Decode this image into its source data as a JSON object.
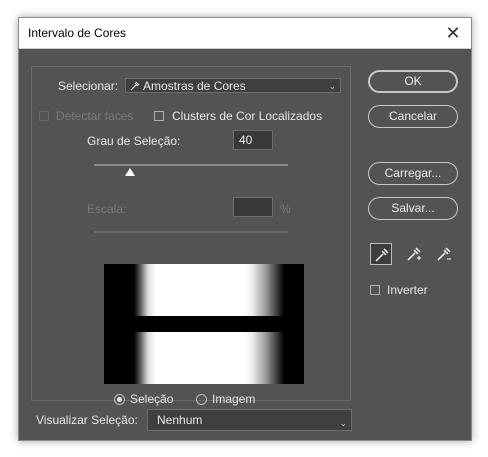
{
  "window": {
    "title": "Intervalo de Cores",
    "close_glyph": "✕"
  },
  "select": {
    "label": "Selecionar:",
    "value": "Amostras de Cores",
    "icon": "eyedropper-icon"
  },
  "options": {
    "detect_faces": "Detectar faces",
    "localized_clusters": "Clusters de Cor Localizados"
  },
  "fuzziness": {
    "label": "Grau de Seleção:",
    "value": "40",
    "slider_fraction": 0.2
  },
  "scale": {
    "label": "Escala:",
    "value": "",
    "unit": "%"
  },
  "preview": {
    "selection_label": "Seleção",
    "image_label": "Imagem",
    "selected": "selection"
  },
  "bottom": {
    "label": "Visualizar Seleção:",
    "value": "Nenhum"
  },
  "buttons": {
    "ok": "OK",
    "cancel": "Cancelar",
    "load": "Carregar...",
    "save": "Salvar..."
  },
  "tools": [
    "eyedropper-icon",
    "eyedropper-plus-icon",
    "eyedropper-minus-icon"
  ],
  "invert": {
    "label": "Inverter"
  }
}
